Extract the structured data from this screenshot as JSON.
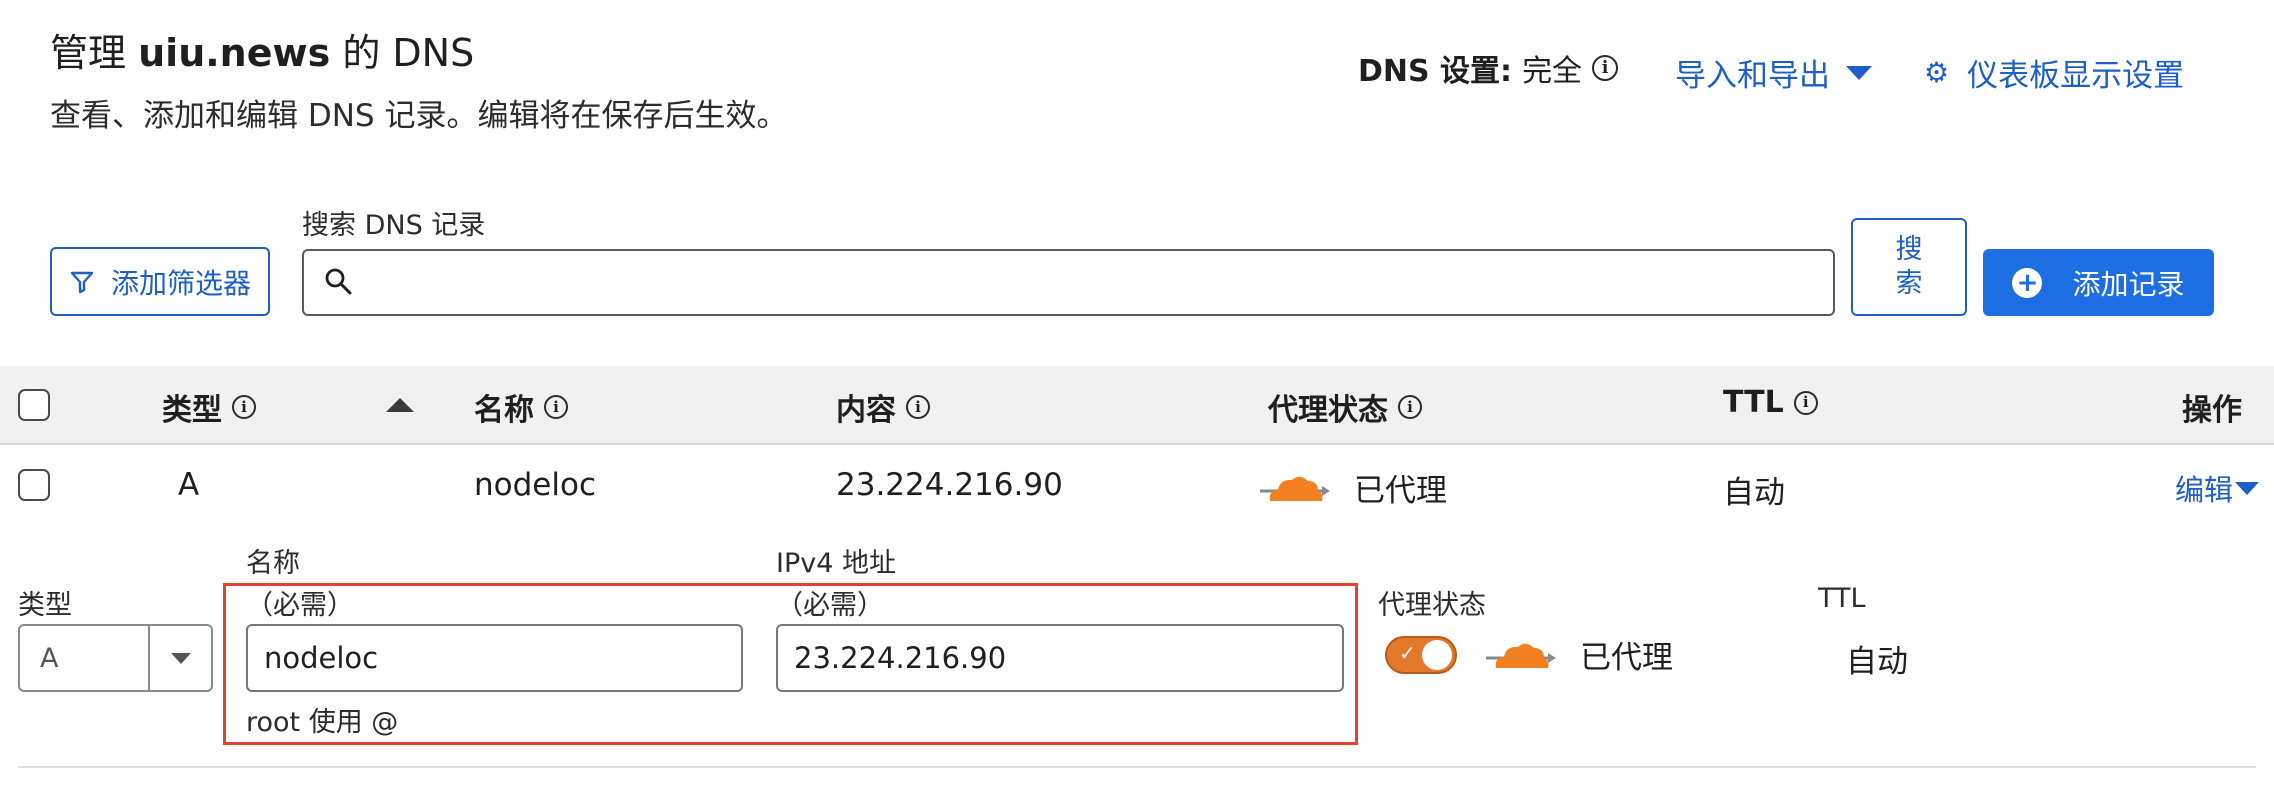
{
  "header": {
    "title_prefix": "管理",
    "title_domain": "uiu.news",
    "title_suffix": "的 DNS",
    "subtitle": "查看、添加和编辑 DNS 记录。编辑将在保存后生效。",
    "dns_setting_label": "DNS 设置:",
    "dns_setting_value": "完全",
    "import_export_label": "导入和导出",
    "dashboard_settings_label": "仪表板显示设置"
  },
  "search": {
    "label": "搜索 DNS 记录",
    "value": "",
    "filter_button_label": "添加筛选器",
    "search_button_line1": "搜",
    "search_button_line2": "索",
    "add_record_label": "添加记录"
  },
  "table": {
    "columns": {
      "type": "类型",
      "name": "名称",
      "content": "内容",
      "proxy_status": "代理状态",
      "ttl": "TTL",
      "actions": "操作"
    },
    "rows": [
      {
        "type": "A",
        "name": "nodeloc",
        "content": "23.224.216.90",
        "proxy_status": "已代理",
        "ttl": "自动",
        "action": "编辑"
      }
    ]
  },
  "edit_form": {
    "type_label": "类型",
    "type_value": "A",
    "name_label": "名称",
    "name_required": "（必需）",
    "name_value": "nodeloc",
    "name_hint": "root 使用 @",
    "ipv4_label": "IPv4 地址",
    "ipv4_required": "（必需）",
    "ipv4_value": "23.224.216.90",
    "proxy_label": "代理状态",
    "proxy_value": "已代理",
    "proxy_enabled": true,
    "ttl_label": "TTL",
    "ttl_value": "自动"
  },
  "colors": {
    "link_blue": "#1d5fc7",
    "primary_button": "#1d6de3",
    "proxy_orange": "#e4782a",
    "highlight_red": "#e2422f",
    "header_bg": "#f1f1f1"
  }
}
